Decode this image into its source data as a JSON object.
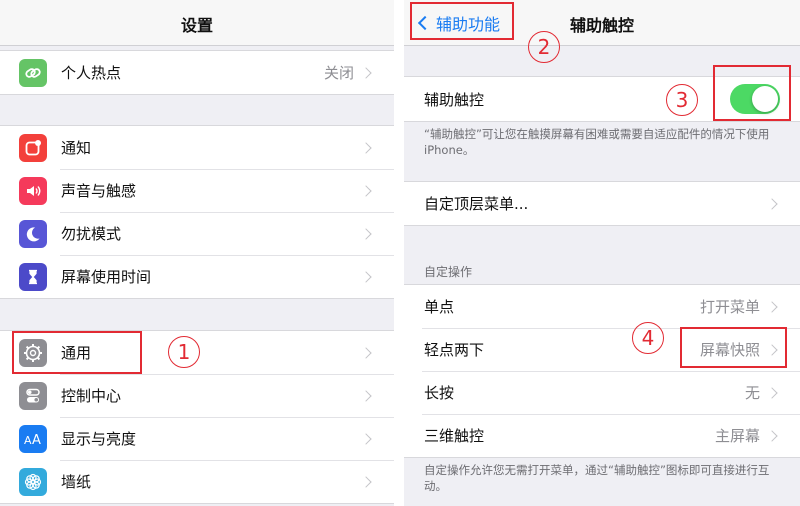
{
  "left": {
    "title": "设置",
    "hotspot": {
      "label": "个人热点",
      "value": "关闭"
    },
    "group2": [
      {
        "label": "通知"
      },
      {
        "label": "声音与触感"
      },
      {
        "label": "勿扰模式"
      },
      {
        "label": "屏幕使用时间"
      }
    ],
    "group3": [
      {
        "label": "通用"
      },
      {
        "label": "控制中心"
      },
      {
        "label": "显示与亮度"
      },
      {
        "label": "墙纸"
      }
    ]
  },
  "right": {
    "back_label": "辅助功能",
    "title": "辅助触控",
    "assistive": {
      "label": "辅助触控",
      "toggle_on": true
    },
    "assistive_note": "“辅助触控”可让您在触摸屏幕有困难或需要自适应配件的情况下使用 iPhone。",
    "custom_menu": {
      "label": "自定顶层菜单..."
    },
    "custom_actions_header": "自定操作",
    "actions": [
      {
        "label": "单点",
        "value": "打开菜单"
      },
      {
        "label": "轻点两下",
        "value": "屏幕快照"
      },
      {
        "label": "长按",
        "value": "无"
      },
      {
        "label": "三维触控",
        "value": "主屏幕"
      }
    ],
    "actions_note": "自定操作允许您无需打开菜单，通过“辅助触控”图标即可直接进行互动。"
  },
  "annotations": {
    "marker1": "1",
    "marker2": "2",
    "marker3": "3",
    "marker4": "4",
    "highlight_color": "#e22a33"
  },
  "colors": {
    "ios_blue": "#1a7cf2",
    "toggle_green": "#4cd964",
    "background": "#efeff4"
  },
  "icons": {
    "hotspot": "link-icon",
    "notifications": "notification-icon",
    "sounds": "speaker-icon",
    "dnd": "moon-icon",
    "screen_time": "hourglass-icon",
    "general": "gear-icon",
    "control_center": "toggles-icon",
    "display": "text-size-icon",
    "wallpaper": "flower-icon"
  }
}
